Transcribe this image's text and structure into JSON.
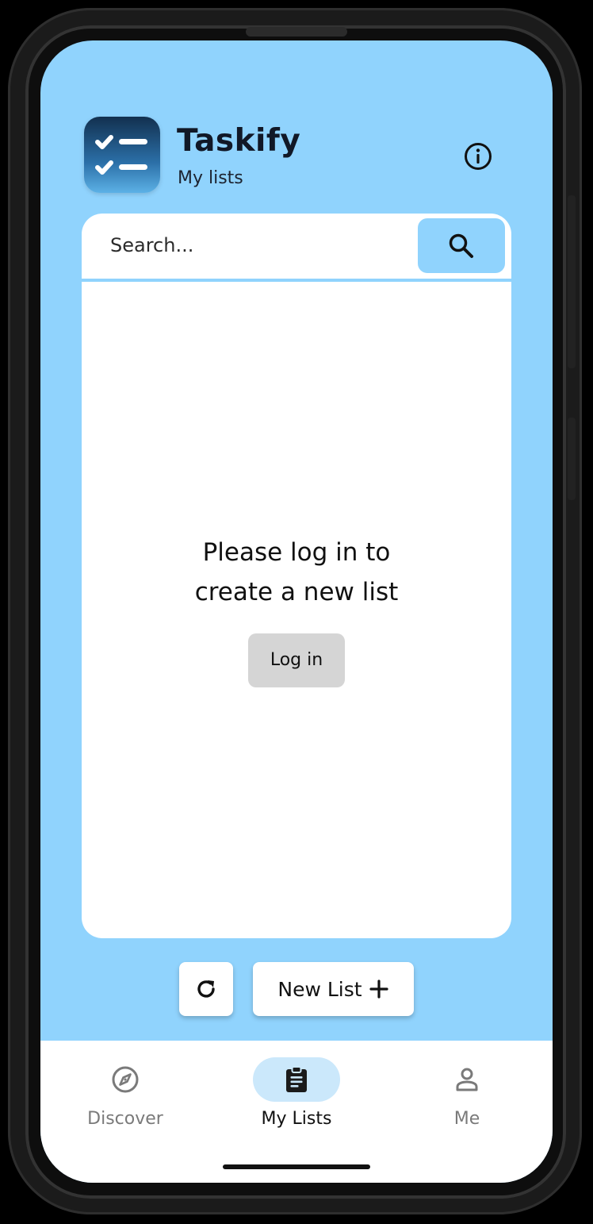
{
  "app": {
    "title": "Taskify",
    "subtitle": "My lists",
    "icon": "checklist-app-icon"
  },
  "header": {
    "info_icon": "info-icon"
  },
  "search": {
    "placeholder": "Search...",
    "value": "",
    "button_icon": "search-icon"
  },
  "empty_state": {
    "line1": "Please log in to",
    "line2": "create a new list",
    "login_label": "Log in"
  },
  "actions": {
    "refresh_icon": "refresh-icon",
    "new_list_label": "New List",
    "new_list_icon": "plus-icon"
  },
  "nav": {
    "items": [
      {
        "label": "Discover",
        "icon": "compass-icon",
        "active": false
      },
      {
        "label": "My Lists",
        "icon": "clipboard-icon",
        "active": true
      },
      {
        "label": "Me",
        "icon": "person-icon",
        "active": false
      }
    ]
  },
  "colors": {
    "background": "#90d3fd",
    "card": "#ffffff",
    "active_pill": "#cbe8fb",
    "login_button": "#d5d5d5",
    "inactive_text": "#7a7a7a"
  }
}
